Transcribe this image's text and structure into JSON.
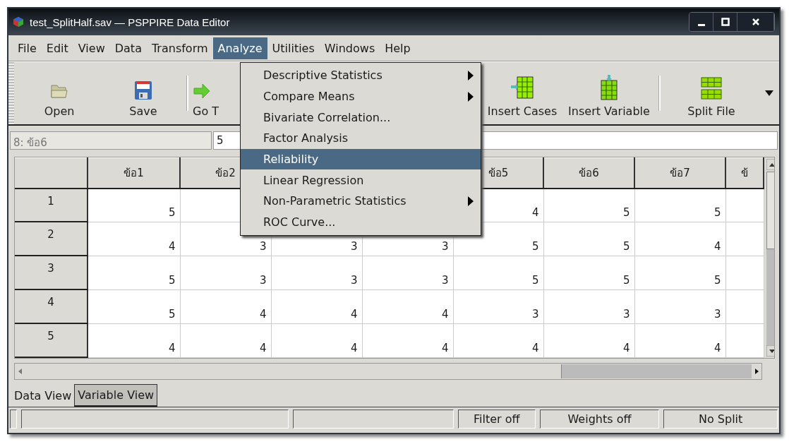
{
  "window": {
    "title": "test_SplitHalf.sav — PSPPIRE Data Editor"
  },
  "menubar": [
    {
      "label": "File",
      "selected": false
    },
    {
      "label": "Edit",
      "selected": false
    },
    {
      "label": "View",
      "selected": false
    },
    {
      "label": "Data",
      "selected": false
    },
    {
      "label": "Transform",
      "selected": false
    },
    {
      "label": "Analyze",
      "selected": true
    },
    {
      "label": "Utilities",
      "selected": false
    },
    {
      "label": "Windows",
      "selected": false
    },
    {
      "label": "Help",
      "selected": false
    }
  ],
  "toolbar": [
    {
      "kind": "open",
      "label": "Open"
    },
    {
      "kind": "save",
      "label": "Save"
    },
    {
      "kind": "separator"
    },
    {
      "kind": "goto",
      "label": "Go T"
    },
    {
      "kind": "gap"
    },
    {
      "kind": "insert-cases",
      "label": "Insert Cases"
    },
    {
      "kind": "insert-variable",
      "label": "Insert Variable"
    },
    {
      "kind": "separator"
    },
    {
      "kind": "split",
      "label": "Split File"
    }
  ],
  "cell_ref": {
    "name": "8: ข้อ6",
    "value": "5"
  },
  "table": {
    "columns": [
      "ข้อ1",
      "ข้อ2",
      null,
      null,
      "ข้อ5",
      "ข้อ6",
      "ข้อ7",
      "ข้"
    ],
    "rows": [
      {
        "label": "1",
        "cells": [
          "5",
          null,
          null,
          null,
          "4",
          "5",
          "5",
          null
        ]
      },
      {
        "label": "2",
        "cells": [
          "4",
          "3",
          "3",
          "3",
          "5",
          "5",
          "4",
          null
        ]
      },
      {
        "label": "3",
        "cells": [
          "5",
          "3",
          "3",
          "3",
          "5",
          "5",
          "5",
          null
        ]
      },
      {
        "label": "4",
        "cells": [
          "5",
          "4",
          "4",
          "4",
          "3",
          "3",
          "3",
          null
        ]
      },
      {
        "label": "5",
        "cells": [
          "4",
          "4",
          "4",
          "4",
          "4",
          "4",
          "4",
          null
        ]
      }
    ]
  },
  "analyze_menu": [
    {
      "label": "Descriptive Statistics",
      "submenu": true,
      "selected": false
    },
    {
      "label": "Compare Means",
      "submenu": true,
      "selected": false
    },
    {
      "label": "Bivariate Correlation...",
      "submenu": false,
      "selected": false
    },
    {
      "label": "Factor Analysis",
      "submenu": false,
      "selected": false
    },
    {
      "label": "Reliability",
      "submenu": false,
      "selected": true
    },
    {
      "label": "Linear Regression",
      "submenu": false,
      "selected": false
    },
    {
      "label": "Non-Parametric Statistics",
      "submenu": true,
      "selected": false
    },
    {
      "label": "ROC Curve...",
      "submenu": false,
      "selected": false
    }
  ],
  "view_tabs": [
    {
      "label": "Data View",
      "selected": true
    },
    {
      "label": "Variable View",
      "selected": false
    }
  ],
  "status_bar": [
    "Filter off",
    "Weights off",
    "No Split"
  ]
}
